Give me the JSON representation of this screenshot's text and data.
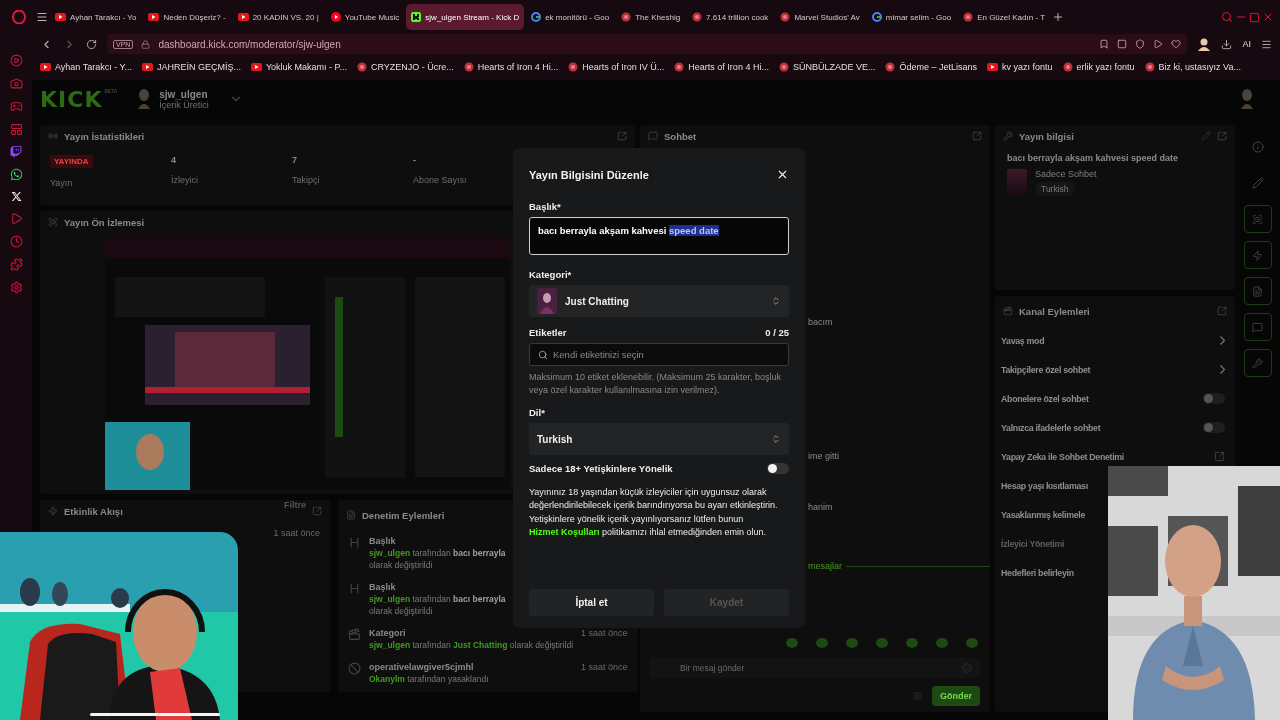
{
  "browser": {
    "tabs": [
      {
        "title": "Ayhan Tarakcı - Yo",
        "kind": "video",
        "selected": false
      },
      {
        "title": "Neden Düşeriz? -",
        "kind": "video",
        "selected": false
      },
      {
        "title": "20 KADIN VS. 20 |",
        "kind": "video",
        "selected": false
      },
      {
        "title": "YouTube Music",
        "kind": "music",
        "selected": false
      },
      {
        "title": "sjw_ulgen Stream - Kick D",
        "kind": "kick",
        "selected": true
      },
      {
        "title": "ek monitörü - Goo",
        "kind": "google",
        "selected": false
      },
      {
        "title": "The Kheshig",
        "kind": "site",
        "selected": false
      },
      {
        "title": "7.614 trillion cook",
        "kind": "site",
        "selected": false
      },
      {
        "title": "Marvel Studios' Av",
        "kind": "site",
        "selected": false
      },
      {
        "title": "mimar selim - Goo",
        "kind": "google",
        "selected": false
      },
      {
        "title": "En Güzel Kadın - T",
        "kind": "site",
        "selected": false
      }
    ],
    "vpn": "VPN",
    "url": "dashboard.kick.com/moderator/sjw-ulgen",
    "ai": "AI",
    "bookmarks": [
      {
        "title": "Ayhan Tarakcı - Y...",
        "kind": "video"
      },
      {
        "title": "JAHREİN GEÇMİŞ...",
        "kind": "video"
      },
      {
        "title": "Yokluk Makamı - P...",
        "kind": "video"
      },
      {
        "title": "CRYZENJO - Ücre...",
        "kind": "site"
      },
      {
        "title": "Hearts of Iron 4 Hi...",
        "kind": "site"
      },
      {
        "title": "Hearts of Iron IV Ü...",
        "kind": "site"
      },
      {
        "title": "Hearts of Iron 4 Hi...",
        "kind": "site"
      },
      {
        "title": "SÜNBÜLZADE VE...",
        "kind": "site"
      },
      {
        "title": "Ödeme – JetLisans",
        "kind": "site"
      },
      {
        "title": "kv yazı fontu",
        "kind": "video"
      },
      {
        "title": "erlik yazı fontu",
        "kind": "site"
      },
      {
        "title": "Biz ki, ustasıyız Va...",
        "kind": "site"
      }
    ]
  },
  "dashboard": {
    "brand": "KICK",
    "brand_tag": "BETA",
    "user": {
      "name": "sjw_ulgen",
      "role": "İçerik Üretici"
    },
    "stats": {
      "title": "Yayın İstatistikleri",
      "items": [
        {
          "kind": "badge",
          "value": "YAYINDA",
          "label": "Yayın"
        },
        {
          "kind": "number",
          "value": "4",
          "label": "İzleyici"
        },
        {
          "kind": "number",
          "value": "7",
          "label": "Takipçi"
        },
        {
          "kind": "number",
          "value": "-",
          "label": "Abone Sayısı"
        }
      ]
    },
    "preview": {
      "title": "Yayın Ön İzlemesi"
    },
    "activity": {
      "title": "Etkinlik Akışı",
      "filter": "Filtre",
      "time": "1 saat önce"
    },
    "moderation": {
      "title": "Denetim Eylemleri",
      "items": [
        {
          "kind": "title",
          "heading": "Başlık",
          "parts": [
            {
              "text": "sjw_ulgen",
              "kind": "user"
            },
            {
              "text": " tarafından ",
              "kind": "plain"
            },
            {
              "text": "bacı berrayla",
              "kind": "bold"
            }
          ],
          "line2": "olarak değiştirildi"
        },
        {
          "kind": "title",
          "heading": "Başlık",
          "parts": [
            {
              "text": "sjw_ulgen",
              "kind": "user"
            },
            {
              "text": " tarafından ",
              "kind": "plain"
            },
            {
              "text": "bacı berrayla",
              "kind": "bold"
            }
          ],
          "line2": "olarak değiştirildi"
        },
        {
          "kind": "category",
          "heading": "Kategori",
          "time": "1 saat önce",
          "parts": [
            {
              "text": "sjw_ulgen",
              "kind": "user"
            },
            {
              "text": " tarafından ",
              "kind": "plain"
            },
            {
              "text": "Just Chatting",
              "kind": "user"
            },
            {
              "text": " olarak değiştirildi",
              "kind": "plain"
            }
          ]
        },
        {
          "kind": "ban",
          "heading": "operativelawgiver5cjmhl",
          "time": "1 saat önce",
          "parts": [
            {
              "text": "Okanylm",
              "kind": "user"
            },
            {
              "text": " tarafından yasaklandı",
              "kind": "plain"
            }
          ]
        }
      ]
    },
    "chat": {
      "title": "Sohbet",
      "messages": [
        "bacım",
        "ime gitti",
        "hanim"
      ],
      "divider": "mesajlar",
      "placeholder": "Bir mesaj gönder",
      "send": "Gönder"
    },
    "stream_info": {
      "title": "Yayın bilgisi",
      "stream_title": "bacı berrayla akşam kahvesi speed date",
      "category": "Sadece Sohbet",
      "language": "Turkish"
    },
    "channel_actions": {
      "title": "Kanal Eylemleri",
      "items": [
        {
          "label": "Yavaş mod",
          "kind": "submenu",
          "disabled": false
        },
        {
          "label": "Takipçilere özel sohbet",
          "kind": "submenu",
          "disabled": false
        },
        {
          "label": "Abonelere özel sohbet",
          "kind": "toggle",
          "on": false,
          "disabled": false
        },
        {
          "label": "Yalnızca ifadelerle sohbet",
          "kind": "toggle",
          "on": false,
          "disabled": false
        },
        {
          "label": "Yapay Zeka ile Sohbet Denetimi",
          "kind": "link",
          "disabled": false
        },
        {
          "label": "Hesap yaşı kısıtlaması",
          "kind": "plain",
          "disabled": false
        },
        {
          "label": "Yasaklanmış kelimele",
          "kind": "plain",
          "disabled": false
        },
        {
          "label": "İzleyici Yönetimi",
          "kind": "plain",
          "disabled": true
        },
        {
          "label": "Hedefleri belirleyin",
          "kind": "plain",
          "disabled": false
        }
      ]
    }
  },
  "modal": {
    "title": "Yayın Bilgisini Düzenle",
    "title_label": "Başlık*",
    "title_parts": [
      {
        "text": "bacı berrayla akşam kahvesi ",
        "selected": false
      },
      {
        "text": "speed date",
        "selected": true
      }
    ],
    "category_label": "Kategori*",
    "category": "Just Chatting",
    "tags_label": "Etiketler",
    "tags_count": "0 / 25",
    "tags_placeholder": "Kendi etiketinizi seçin",
    "tags_help": "Maksimum 10 etiket eklenebilir. (Maksimum 25 karakter, boşluk veya özel karakter kullanılmasına izin verilmez).",
    "language_label": "Dil*",
    "language": "Turkish",
    "mature": {
      "label": "Sadece 18+ Yetişkinlere Yönelik",
      "on": false
    },
    "notice": {
      "before": "Yayınınız 18 yaşından küçük izleyiciler için uygunsuz olarak değerlendirilebilecek içerik barındırıyorsa bu ayarı etkinleştirin. Yetişkinlere yönelik içerik yayınlıyorsanız lütfen bunun ",
      "link": "Hizmet Koşulları",
      "after": " politikamızı ihlal etmediğinden emin olun."
    },
    "cancel": "İptal et",
    "save": {
      "label": "Kaydet",
      "disabled": true
    }
  }
}
